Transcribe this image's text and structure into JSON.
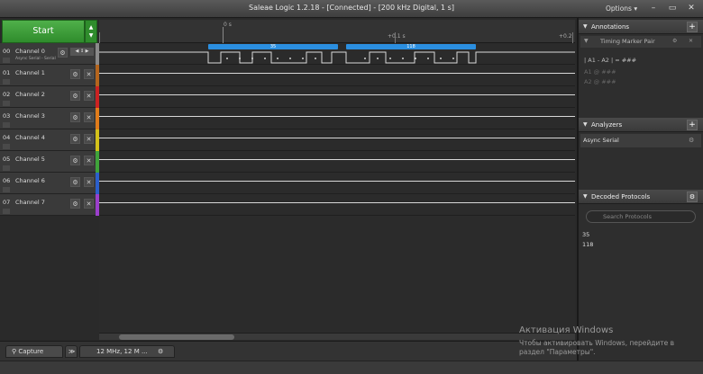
{
  "window": {
    "title": "Saleae Logic 1.2.18 - [Connected] - [200 kHz Digital, 1 s]",
    "options_label": "Options ▾",
    "minimize": "–",
    "maximize": "▭",
    "close": "✕"
  },
  "start": {
    "label": "Start",
    "up": "▲",
    "down": "▼"
  },
  "ruler": {
    "origin": "0 s",
    "mid": "+0.1 s",
    "right": "+0.2"
  },
  "channels": [
    {
      "num": "00",
      "name": "Channel 0",
      "sub": "Async Serial - Serial",
      "color": "#8a8a8a"
    },
    {
      "num": "01",
      "name": "Channel 1",
      "color": "#b5651d"
    },
    {
      "num": "02",
      "name": "Channel 2",
      "color": "#cc2222"
    },
    {
      "num": "03",
      "name": "Channel 3",
      "color": "#e07b1a"
    },
    {
      "num": "04",
      "name": "Channel 4",
      "color": "#d4c21a"
    },
    {
      "num": "05",
      "name": "Channel 5",
      "color": "#3fa33a"
    },
    {
      "num": "06",
      "name": "Channel 6",
      "color": "#2b5fcc"
    },
    {
      "num": "07",
      "name": "Channel 7",
      "color": "#9b3fcc"
    }
  ],
  "ch0_controls": "◀ ↕ ▶",
  "icons": {
    "gear": "⚙",
    "close": "✕"
  },
  "decoded_bubbles": [
    {
      "label": "35"
    },
    {
      "label": "118"
    }
  ],
  "annotations": {
    "title": "Annotations",
    "plus": "+",
    "timing_marker": "Timing Marker Pair",
    "equation": "| A1 - A2 | = ###",
    "a1": "A1 @ ###",
    "a2": "A2 @ ###"
  },
  "analyzers": {
    "title": "Analyzers",
    "plus": "+",
    "items": [
      "Async Serial"
    ]
  },
  "decoded_protocols": {
    "title": "Decoded Protocols",
    "search_placeholder": "Search Protocols",
    "values": [
      "35",
      "118"
    ]
  },
  "bottom": {
    "capture_tab": "Capture",
    "sample_tab": "12 MHz, 12 M ...",
    "arrows": "≫"
  },
  "watermark": {
    "line1": "Активация Windows",
    "line2": "Чтобы активировать Windows, перейдите в раздел \"Параметры\"."
  }
}
